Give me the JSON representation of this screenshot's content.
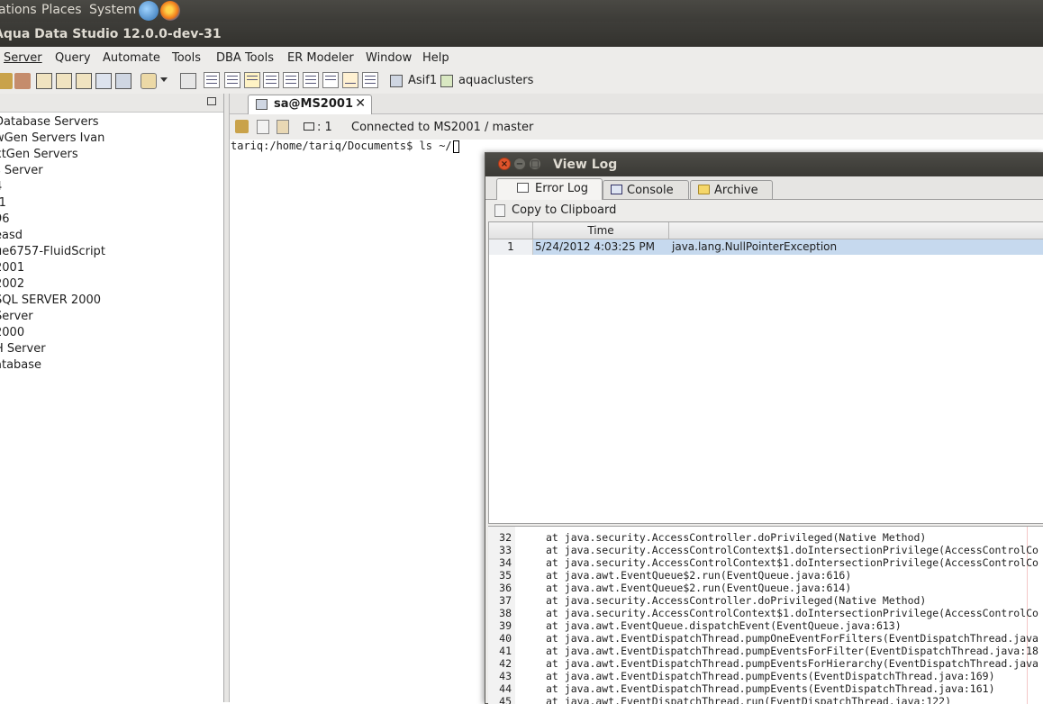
{
  "top_panel": {
    "menus": [
      "ations",
      "Places",
      "System"
    ],
    "icons": [
      "system-spiral-icon",
      "firefox-icon"
    ]
  },
  "window": {
    "title": "Aqua Data Studio 12.0.0-dev-31"
  },
  "menubar": [
    "Server",
    "Query",
    "Automate",
    "Tools",
    "DBA Tools",
    "ER Modeler",
    "Window",
    "Help"
  ],
  "toolbar": {
    "server_labels": [
      "Asif1",
      "aquaclusters"
    ]
  },
  "tree": {
    "items": [
      "Database Servers",
      "wGen Servers Ivan",
      "xtGen Servers",
      "s Server",
      "4",
      "f1",
      "96",
      "easd",
      "ue6757-FluidScript",
      "2001",
      "2002",
      " SQL SERVER 2000",
      "Server",
      "2000",
      "H Server",
      "atabase"
    ]
  },
  "editor": {
    "tab_title": "sa@MS2001",
    "tab_close": "✕",
    "row_count": ": 1",
    "status": "Connected to MS2001 / master",
    "terminal_line": "tariq:/home/tariq/Documents$ ls ~/"
  },
  "dialog": {
    "title": "View Log",
    "tabs": [
      "Error Log",
      "Console",
      "Archive"
    ],
    "copy_label": "Copy to Clipboard",
    "columns": [
      "Time",
      ""
    ],
    "rows": [
      {
        "num": "1",
        "time": "5/24/2012 4:03:25 PM",
        "message": "java.lang.NullPointerException"
      }
    ],
    "detail_lines": [
      {
        "n": "32",
        "text": "at java.security.AccessController.doPrivileged(Native Method)"
      },
      {
        "n": "33",
        "text": "at java.security.AccessControlContext$1.doIntersectionPrivilege(AccessControlCo"
      },
      {
        "n": "34",
        "text": "at java.security.AccessControlContext$1.doIntersectionPrivilege(AccessControlCo"
      },
      {
        "n": "35",
        "text": "at java.awt.EventQueue$2.run(EventQueue.java:616)"
      },
      {
        "n": "36",
        "text": "at java.awt.EventQueue$2.run(EventQueue.java:614)"
      },
      {
        "n": "37",
        "text": "at java.security.AccessController.doPrivileged(Native Method)"
      },
      {
        "n": "38",
        "text": "at java.security.AccessControlContext$1.doIntersectionPrivilege(AccessControlCo"
      },
      {
        "n": "39",
        "text": "at java.awt.EventQueue.dispatchEvent(EventQueue.java:613)"
      },
      {
        "n": "40",
        "text": "at java.awt.EventDispatchThread.pumpOneEventForFilters(EventDispatchThread.java"
      },
      {
        "n": "41",
        "text": "at java.awt.EventDispatchThread.pumpEventsForFilter(EventDispatchThread.java:18"
      },
      {
        "n": "42",
        "text": "at java.awt.EventDispatchThread.pumpEventsForHierarchy(EventDispatchThread.java"
      },
      {
        "n": "43",
        "text": "at java.awt.EventDispatchThread.pumpEvents(EventDispatchThread.java:169)"
      },
      {
        "n": "44",
        "text": "at java.awt.EventDispatchThread.pumpEvents(EventDispatchThread.java:161)"
      },
      {
        "n": "45",
        "text": "at java.awt.EventDispatchThread.run(EventDispatchThread.java:122)"
      }
    ]
  },
  "colors": {
    "panel_bg": "#3c3b37",
    "selected_row": "#c6d9ee",
    "close_button": "#e0542b"
  }
}
